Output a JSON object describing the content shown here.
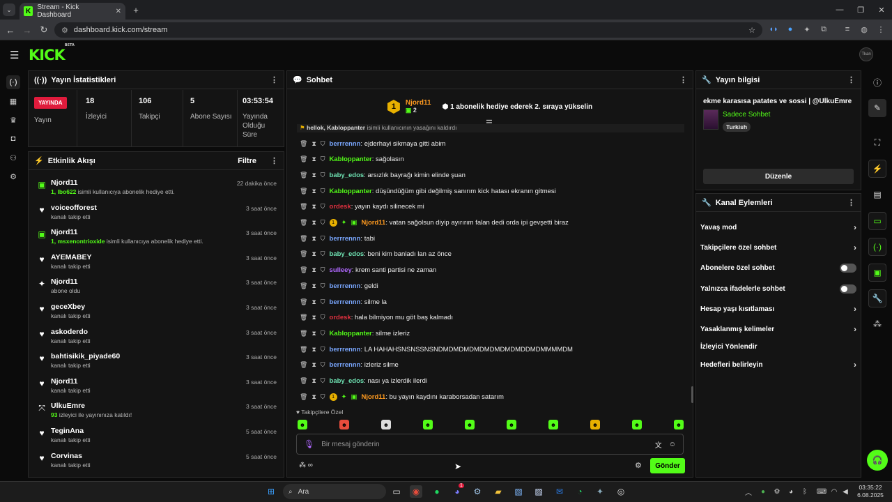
{
  "browser": {
    "tab_title": "Stream - Kick Dashboard",
    "url": "dashboard.kick.com/stream"
  },
  "app": {
    "logo": "KICK",
    "logo_badge": "BETA",
    "avatar_text": "Tkan"
  },
  "stats": {
    "title": "Yayın İstatistikleri",
    "live_badge": "YAYINDA",
    "live_label": "Yayın",
    "viewers": "18",
    "viewers_label": "İzleyici",
    "followers": "106",
    "followers_label": "Takipçi",
    "subs": "5",
    "subs_label": "Abone Sayısı",
    "duration": "03:53:54",
    "duration_label": "Yayında Olduğu Süre"
  },
  "activity": {
    "title": "Etkinlik Akışı",
    "filter": "Filtre",
    "items": [
      {
        "icon": "gift-icon",
        "name": "Njord11",
        "pre": "1, ",
        "hl": "Ibo622",
        "desc": " isimli kullanıcıya abonelik hediye etti.",
        "time": "22 dakika önce"
      },
      {
        "icon": "heart-icon",
        "name": "voiceofforest",
        "pre": "",
        "hl": "",
        "desc": "kanalı takip etti",
        "time": "3 saat önce"
      },
      {
        "icon": "gift-icon",
        "name": "Njord11",
        "pre": "1, ",
        "hl": "msxenontrioxide",
        "desc": " isimli kullanıcıya abonelik hediye etti.",
        "time": "3 saat önce"
      },
      {
        "icon": "heart-icon",
        "name": "AYEMABEY",
        "pre": "",
        "hl": "",
        "desc": "kanalı takip etti",
        "time": "3 saat önce"
      },
      {
        "icon": "star-icon",
        "name": "Njord11",
        "pre": "",
        "hl": "",
        "desc": "abone oldu",
        "time": "3 saat önce"
      },
      {
        "icon": "heart-icon",
        "name": "geceXbey",
        "pre": "",
        "hl": "",
        "desc": "kanalı takip etti",
        "time": "3 saat önce"
      },
      {
        "icon": "heart-icon",
        "name": "askoderdo",
        "pre": "",
        "hl": "",
        "desc": "kanalı takip etti",
        "time": "3 saat önce"
      },
      {
        "icon": "heart-icon",
        "name": "bahtisikik_piyade60",
        "pre": "",
        "hl": "",
        "desc": "kanalı takip etti",
        "time": "3 saat önce"
      },
      {
        "icon": "heart-icon",
        "name": "Njord11",
        "pre": "",
        "hl": "",
        "desc": "kanalı takip etti",
        "time": "3 saat önce"
      },
      {
        "icon": "raid-icon",
        "name": "UlkuEmre",
        "pre": "",
        "hl": "93",
        "desc": " izleyici ile yayınınıza katıldı!",
        "time": "3 saat önce"
      },
      {
        "icon": "heart-icon",
        "name": "TeginAna",
        "pre": "",
        "hl": "",
        "desc": "kanalı takip etti",
        "time": "5 saat önce"
      },
      {
        "icon": "heart-icon",
        "name": "Corvinas",
        "pre": "",
        "hl": "",
        "desc": "kanalı takip etti",
        "time": "5 saat önce"
      }
    ]
  },
  "chat": {
    "title": "Sohbet",
    "pinned_user": "Njord11",
    "pinned_rank": "1",
    "pinned_count": "2",
    "pinned_text": "1 abonelik hediye ederek 2. sıraya yükselin",
    "removed_notice_user": "hellok, Kabloppanter",
    "removed_notice_text": "isimli kullanıcının yasağını kaldırdı",
    "messages": [
      {
        "user": "berrrennn",
        "color": "#7aa7ff",
        "text": "ejderhayi sikmaya gitti abim",
        "badges": ""
      },
      {
        "user": "Kabloppanter",
        "color": "#53fc18",
        "text": "sağolasın",
        "badges": ""
      },
      {
        "user": "baby_edos",
        "color": "#6fe3b3",
        "text": "arsızlık bayrağı kimin elinde şuan",
        "badges": ""
      },
      {
        "user": "Kabloppanter",
        "color": "#53fc18",
        "text": "düşündüğüm gibi değilmiş sanırım kick hatası ekranın gitmesi",
        "badges": ""
      },
      {
        "user": "ordesk",
        "color": "#e0303f",
        "text": "yayın kaydı silinecek mi",
        "badges": ""
      },
      {
        "user": "Njord11",
        "color": "#ff9a1f",
        "text": "vatan sağolsun diyip ayırırım falan dedi orda ipi gevşetti biraz",
        "badges": "vip"
      },
      {
        "user": "berrrennn",
        "color": "#7aa7ff",
        "text": "tabi",
        "badges": ""
      },
      {
        "user": "baby_edos",
        "color": "#6fe3b3",
        "text": "beni kim banladı lan az önce",
        "badges": ""
      },
      {
        "user": "sulleey",
        "color": "#b068ff",
        "text": "krem santi partisi ne zaman",
        "badges": ""
      },
      {
        "user": "berrrennn",
        "color": "#7aa7ff",
        "text": "geldi",
        "badges": ""
      },
      {
        "user": "berrrennn",
        "color": "#7aa7ff",
        "text": "silme la",
        "badges": ""
      },
      {
        "user": "ordesk",
        "color": "#e0303f",
        "text": "hala bilmiyon mu göt baş kalmadı",
        "badges": ""
      },
      {
        "user": "Kabloppanter",
        "color": "#53fc18",
        "text": "silme izleriz",
        "badges": ""
      },
      {
        "user": "berrrennn",
        "color": "#7aa7ff",
        "text": "LA HAHAHSNSNSSNSNDMDMDMDMDMDMDMDMDDMDMMMMDM",
        "badges": ""
      },
      {
        "user": "berrrennn",
        "color": "#7aa7ff",
        "text": "izleriz silme",
        "badges": ""
      },
      {
        "user": "baby_edos",
        "color": "#6fe3b3",
        "text": "nası ya izlerdik ilerdi",
        "badges": ""
      },
      {
        "user": "Njord11",
        "color": "#ff9a1f",
        "text": "bu yayın kaydını karaborsadan satarım",
        "badges": "vip"
      }
    ],
    "mode_label": "Takipçilere Özel",
    "input_placeholder": "Bir mesaj gönderin",
    "send_label": "Gönder"
  },
  "info": {
    "title": "Yayın bilgisi",
    "stream_title": "ekme karasısa patates ve sossi | @UlkuEmre",
    "category": "Sadece Sohbet",
    "language": "Turkish",
    "edit_label": "Düzenle"
  },
  "actions": {
    "title": "Kanal Eylemleri",
    "items": [
      {
        "label": "Yavaş mod",
        "kind": "chevron"
      },
      {
        "label": "Takipçilere özel sohbet",
        "kind": "chevron"
      },
      {
        "label": "Abonelere özel sohbet",
        "kind": "toggle"
      },
      {
        "label": "Yalnızca ifadelerle sohbet",
        "kind": "toggle"
      },
      {
        "label": "Hesap yaşı kısıtlaması",
        "kind": "chevron"
      },
      {
        "label": "Yasaklanmış kelimeler",
        "kind": "chevron"
      },
      {
        "label": "İzleyici Yönlendir",
        "kind": "none"
      },
      {
        "label": "Hedefleri belirleyin",
        "kind": "chevron"
      }
    ]
  },
  "taskbar": {
    "search_label": "Ara",
    "time": "03:35:22",
    "date": "6.08.2025",
    "discord_badge": "1"
  },
  "colors": {
    "accent": "#53fc18",
    "live": "#e01b3c",
    "panel": "#141414"
  }
}
